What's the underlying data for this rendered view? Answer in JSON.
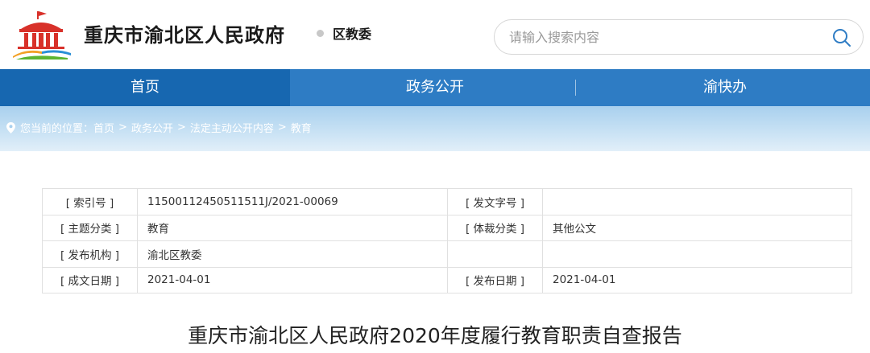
{
  "header": {
    "site_title": "重庆市渝北区人民政府",
    "sub_title": "区教委",
    "search_placeholder": "请输入搜索内容"
  },
  "nav": {
    "items": [
      {
        "label": "首页",
        "active": true
      },
      {
        "label": "政务公开",
        "active": false
      },
      {
        "label": "渝快办",
        "active": false
      }
    ]
  },
  "breadcrumb": {
    "prefix": "您当前的位置：",
    "items": [
      "首页",
      "政务公开",
      "法定主动公开内容",
      "教育"
    ],
    "separator": ">"
  },
  "info": {
    "rows": [
      {
        "label1": "[ 索引号 ]",
        "value1": "11500112450511511J/2021-00069",
        "label2": "[ 发文字号 ]",
        "value2": ""
      },
      {
        "label1": "[ 主题分类 ]",
        "value1": "教育",
        "label2": "[ 体裁分类 ]",
        "value2": "其他公文"
      },
      {
        "label1": "[ 发布机构 ]",
        "value1": "渝北区教委",
        "label2": "",
        "value2": ""
      },
      {
        "label1": "[ 成文日期 ]",
        "value1": "2021-04-01",
        "label2": "[ 发布日期 ]",
        "value2": "2021-04-01"
      }
    ]
  },
  "document": {
    "title": "重庆市渝北区人民政府2020年度履行教育职责自查报告"
  },
  "colors": {
    "nav_bg": "#2e7cc4",
    "nav_active": "#1767b0",
    "logo_red": "#d8312a",
    "logo_orange": "#f2a126",
    "logo_blue": "#2a8fd6",
    "logo_green": "#5cb531"
  },
  "icons": {
    "logo": "government-building-emblem",
    "search": "search-icon",
    "location": "location-pin-icon"
  }
}
